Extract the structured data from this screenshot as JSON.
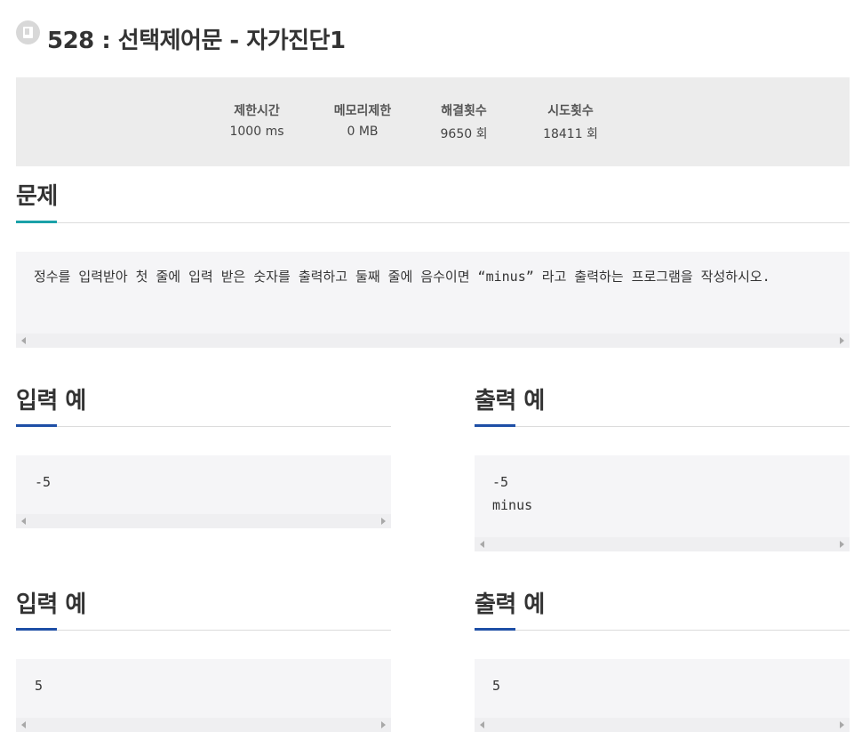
{
  "problem": {
    "title": "528 : 선택제어문 - 자가진단1"
  },
  "stats": [
    {
      "label": "제한시간",
      "value": "1000 ms"
    },
    {
      "label": "메모리제한",
      "value": "0 MB"
    },
    {
      "label": "해결횟수",
      "value": "9650 회"
    },
    {
      "label": "시도횟수",
      "value": "18411 회"
    }
  ],
  "sections": {
    "problem_heading": "문제",
    "problem_text": "정수를 입력받아 첫 줄에 입력 받은 숫자를 출력하고 둘째 줄에 음수이면 “minus” 라고 출력하는 프로그램을 작성하시오.",
    "input_heading_1": "입력 예",
    "output_heading_1": "출력 예",
    "input_example_1": "-5",
    "output_example_1": "-5\nminus",
    "input_heading_2": "입력 예",
    "output_heading_2": "출력 예",
    "input_example_2": "5",
    "output_example_2": "5"
  },
  "colors": {
    "problem_accent": "#1aa1a8",
    "example_accent": "#1e4fa6",
    "box_bg": "#f5f5f7",
    "stats_bg": "#ececec"
  },
  "icons": {
    "title": "document-icon",
    "scroll_left": "arrow-left-icon",
    "scroll_right": "arrow-right-icon"
  }
}
